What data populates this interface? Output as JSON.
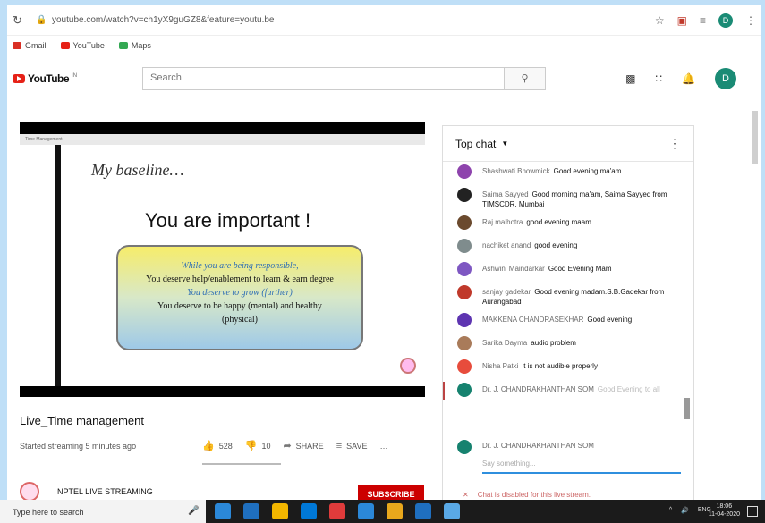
{
  "browser": {
    "url": "youtube.com/watch?v=ch1yX9guGZ8&feature=youtu.be",
    "profile_initial": "D",
    "bookmarks": [
      {
        "label": "Gmail",
        "color": "#d93025"
      },
      {
        "label": "YouTube",
        "color": "#e62117"
      },
      {
        "label": "Maps",
        "color": "#34a853"
      }
    ]
  },
  "youtube": {
    "logo_text": "YouTube",
    "logo_sup": "IN",
    "search_placeholder": "Search",
    "avatar_initial": "D"
  },
  "video": {
    "slide": {
      "tab_label": "Time Management",
      "title": "My baseline…",
      "headline": "You are important !",
      "box_lines": [
        "While you are being responsible,",
        "You deserve help/enablement to learn & earn degree",
        "You deserve to grow (further)",
        "You deserve to be happy (mental) and healthy",
        "(physical)"
      ]
    },
    "title": "Live_Time management",
    "meta": "Started streaming 5 minutes ago",
    "likes": "528",
    "dislikes": "10",
    "share_label": "SHARE",
    "save_label": "SAVE",
    "more_label": "…"
  },
  "channel": {
    "name": "NPTEL LIVE STREAMING",
    "subscribe_label": "SUBSCRIBE"
  },
  "chat": {
    "header": "Top chat",
    "messages": [
      {
        "author": "Shashwati Bhowmick",
        "text": "Good evening ma'am",
        "color": "#8e44ad"
      },
      {
        "author": "Saima Sayyed",
        "text": "Good morning ma'am, Saima Sayyed from TIMSCDR, Mumbai",
        "color": "#222222"
      },
      {
        "author": "Raj malhotra",
        "text": "good evening maam",
        "color": "#6b4a2e"
      },
      {
        "author": "nachiket anand",
        "text": "good evening",
        "color": "#7f8c8d"
      },
      {
        "author": "Ashwini Maindarkar",
        "text": "Good Evening Mam",
        "color": "#7e57c2"
      },
      {
        "author": "sanjay gadekar",
        "text": "Good evening madam.S.B.Gadekar from Aurangabad",
        "color": "#c0392b"
      },
      {
        "author": "MAKKENA CHANDRASEKHAR",
        "text": "Good evening",
        "color": "#5e35b1"
      },
      {
        "author": "Sarika Dayma",
        "text": "audio problem",
        "color": "#a97b5a"
      },
      {
        "author": "Nisha Patki",
        "text": "it is not audible properly",
        "color": "#e74c3c"
      },
      {
        "author": "Dr. J. CHANDRAKHANTHAN SOM",
        "text": "Good Evening to all",
        "color": "#16826f"
      }
    ],
    "compose_name": "Dr. J. CHANDRAKHANTHAN SOM",
    "compose_placeholder": "Say something...",
    "disabled_text": "Chat is disabled for this live stream."
  },
  "taskbar": {
    "search_text": "Type here to search",
    "lang": "ENG",
    "time": "18:06",
    "date": "11-04-2020",
    "app_colors": [
      "#2b88d8",
      "#1f6fbf",
      "#f2b600",
      "#0078d7",
      "#e03b3b",
      "#2b88d8",
      "#e9a81c",
      "#1f6fbf",
      "#5aa9e6"
    ]
  }
}
